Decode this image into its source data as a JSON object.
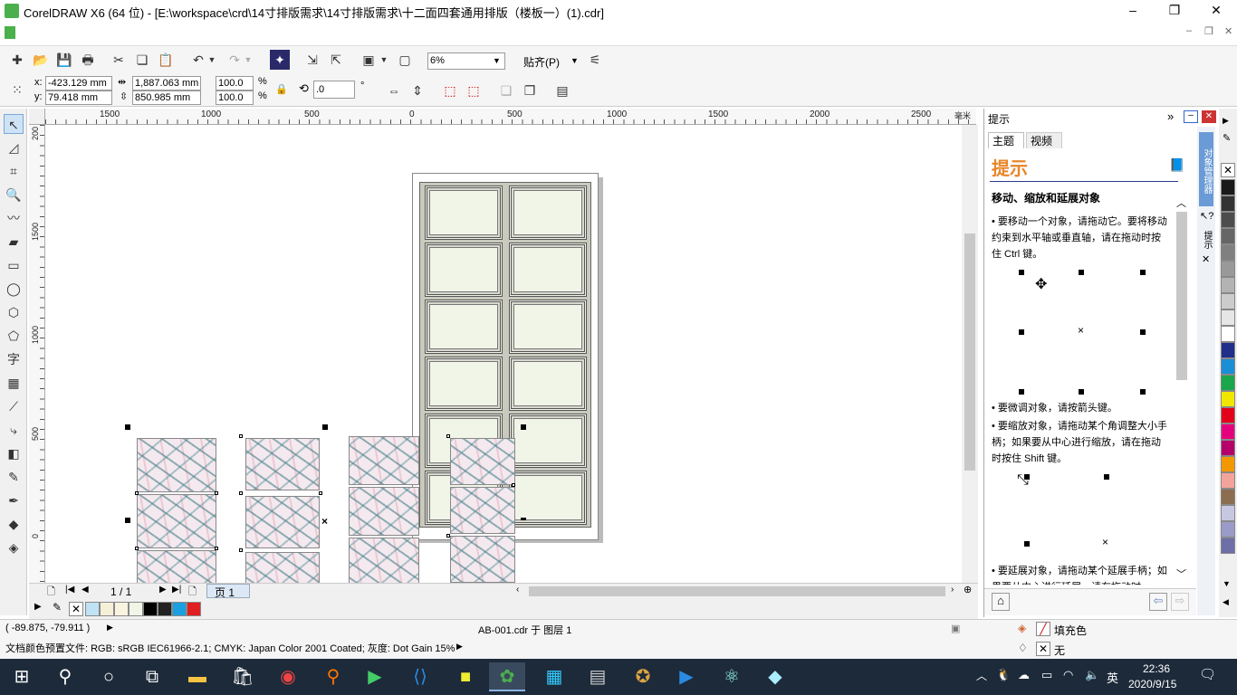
{
  "window": {
    "title": "CorelDRAW X6 (64 位) - [E:\\workspace\\crd\\14寸排版需求\\14寸排版需求\\十二面四套通用排版（楼板一）(1).cdr]",
    "minimize": "–",
    "maximize": "❐",
    "close": "✕"
  },
  "toolbar": {
    "zoom": "6%",
    "snap_label": "贴齐(P)"
  },
  "props": {
    "x_label": "x:",
    "y_label": "y:",
    "x": "-423.129 mm",
    "y": "79.418 mm",
    "width": "1,887.063 mm",
    "height": "850.985 mm",
    "scale_x": "100.0",
    "scale_y": "100.0",
    "pct": "%",
    "angle": ".0",
    "deg": "°"
  },
  "ruler": {
    "h_labels": [
      "1500",
      "1000",
      "500",
      "0",
      "500",
      "1000",
      "1500",
      "2000",
      "2500"
    ],
    "h_unit": "毫米",
    "v_labels": [
      "200",
      "1500",
      "1000",
      "500",
      "0"
    ]
  },
  "page_nav": {
    "count": "1 / 1",
    "tab": "页 1"
  },
  "docker": {
    "title": "提示",
    "tab_topic": "主题",
    "tab_video": "视频",
    "heading": "提示",
    "section_title": "移动、缩放和延展对象",
    "tip1": "要移动一个对象，请拖动它。要将移动约束到水平轴或垂直轴，请在拖动时按住 Ctrl 键。",
    "tip2": "要微调对象，请按箭头键。",
    "tip3": "要缩放对象，请拖动某个角调整大小手柄；如果要从中心进行缩放，请在拖动时按住 Shift 键。",
    "tip4": "要延展对象，请拖动某个延展手柄；如果要从中心进行延展，请在拖动时",
    "side_tab1": "对象管理器",
    "side_tab2": "提示"
  },
  "status": {
    "coords": "( -89.875, -79.911 )",
    "layer": "AB-001.cdr 于 图层 1",
    "fill_label": "填充色",
    "outline_label": "无",
    "color_profile": "文档颜色预置文件: RGB: sRGB IEC61966-2.1; CMYK: Japan Color 2001 Coated; 灰度: Dot Gain 15%"
  },
  "taskbar": {
    "time": "22:36",
    "date": "2020/9/15",
    "lang": "英"
  },
  "colors": {
    "palette_bottom": [
      "#bfe3f5",
      "#f5f0d8",
      "#f8f4e0",
      "#f1f5e8",
      "#000000",
      "#222222",
      "#1aa0e0",
      "#e02020"
    ],
    "palette_right": [
      "#1a1a1a",
      "#333333",
      "#4d4d4d",
      "#666666",
      "#808080",
      "#999999",
      "#b3b3b3",
      "#cccccc",
      "#e6e6e6",
      "#ffffff",
      "#1f2f8a",
      "#1a8fd6",
      "#1aa64b",
      "#f0e600",
      "#e2001a",
      "#e5007e",
      "#b3006a",
      "#f39800",
      "#f4a39a",
      "#8c6d4f",
      "#c7c7e2",
      "#9b9bc9",
      "#6e6ea8"
    ],
    "docker_heading": "#e8862a"
  }
}
